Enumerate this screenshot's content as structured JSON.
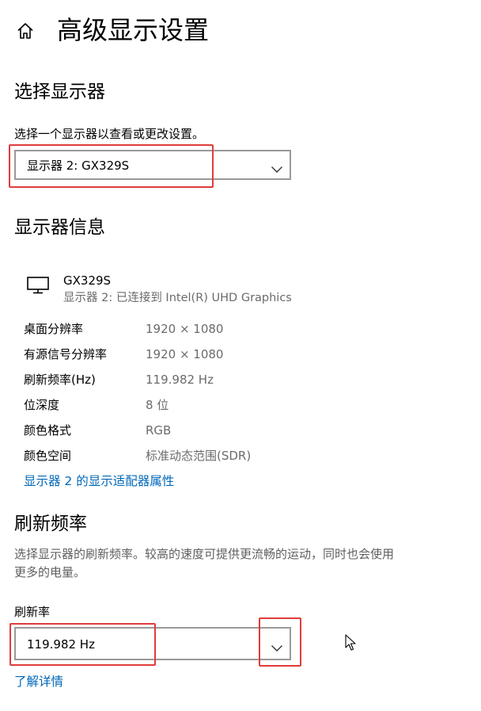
{
  "header": {
    "title": "高级显示设置"
  },
  "select_display": {
    "heading": "选择显示器",
    "description": "选择一个显示器以查看或更改设置。",
    "dropdown_value": "显示器 2: GX329S"
  },
  "display_info": {
    "heading": "显示器信息",
    "monitor_name": "GX329S",
    "monitor_connection": "显示器 2: 已连接到 Intel(R) UHD Graphics",
    "rows": [
      {
        "label": "桌面分辨率",
        "value": "1920 × 1080"
      },
      {
        "label": "有源信号分辨率",
        "value": "1920 × 1080"
      },
      {
        "label": "刷新频率(Hz)",
        "value": "119.982 Hz"
      },
      {
        "label": "位深度",
        "value": "8 位"
      },
      {
        "label": "颜色格式",
        "value": "RGB"
      },
      {
        "label": "颜色空间",
        "value": "标准动态范围(SDR)"
      }
    ],
    "adapter_link": "显示器 2 的显示适配器属性"
  },
  "refresh_rate": {
    "heading": "刷新频率",
    "description_line1": "选择显示器的刷新频率。较高的速度可提供更流畅的运动，同时也会使用",
    "description_line2": "更多的电量。",
    "field_label": "刷新率",
    "dropdown_value": "119.982 Hz",
    "learn_more_link": "了解详情"
  },
  "icons": {
    "home": "home-icon",
    "monitor": "monitor-icon",
    "chevron": "chevron-down-icon",
    "cursor": "mouse-cursor-icon"
  },
  "colors": {
    "link": "#0067b8",
    "highlight": "#e03c3c",
    "dropdown_border": "#999999",
    "secondary_text": "#6b6b6b"
  }
}
